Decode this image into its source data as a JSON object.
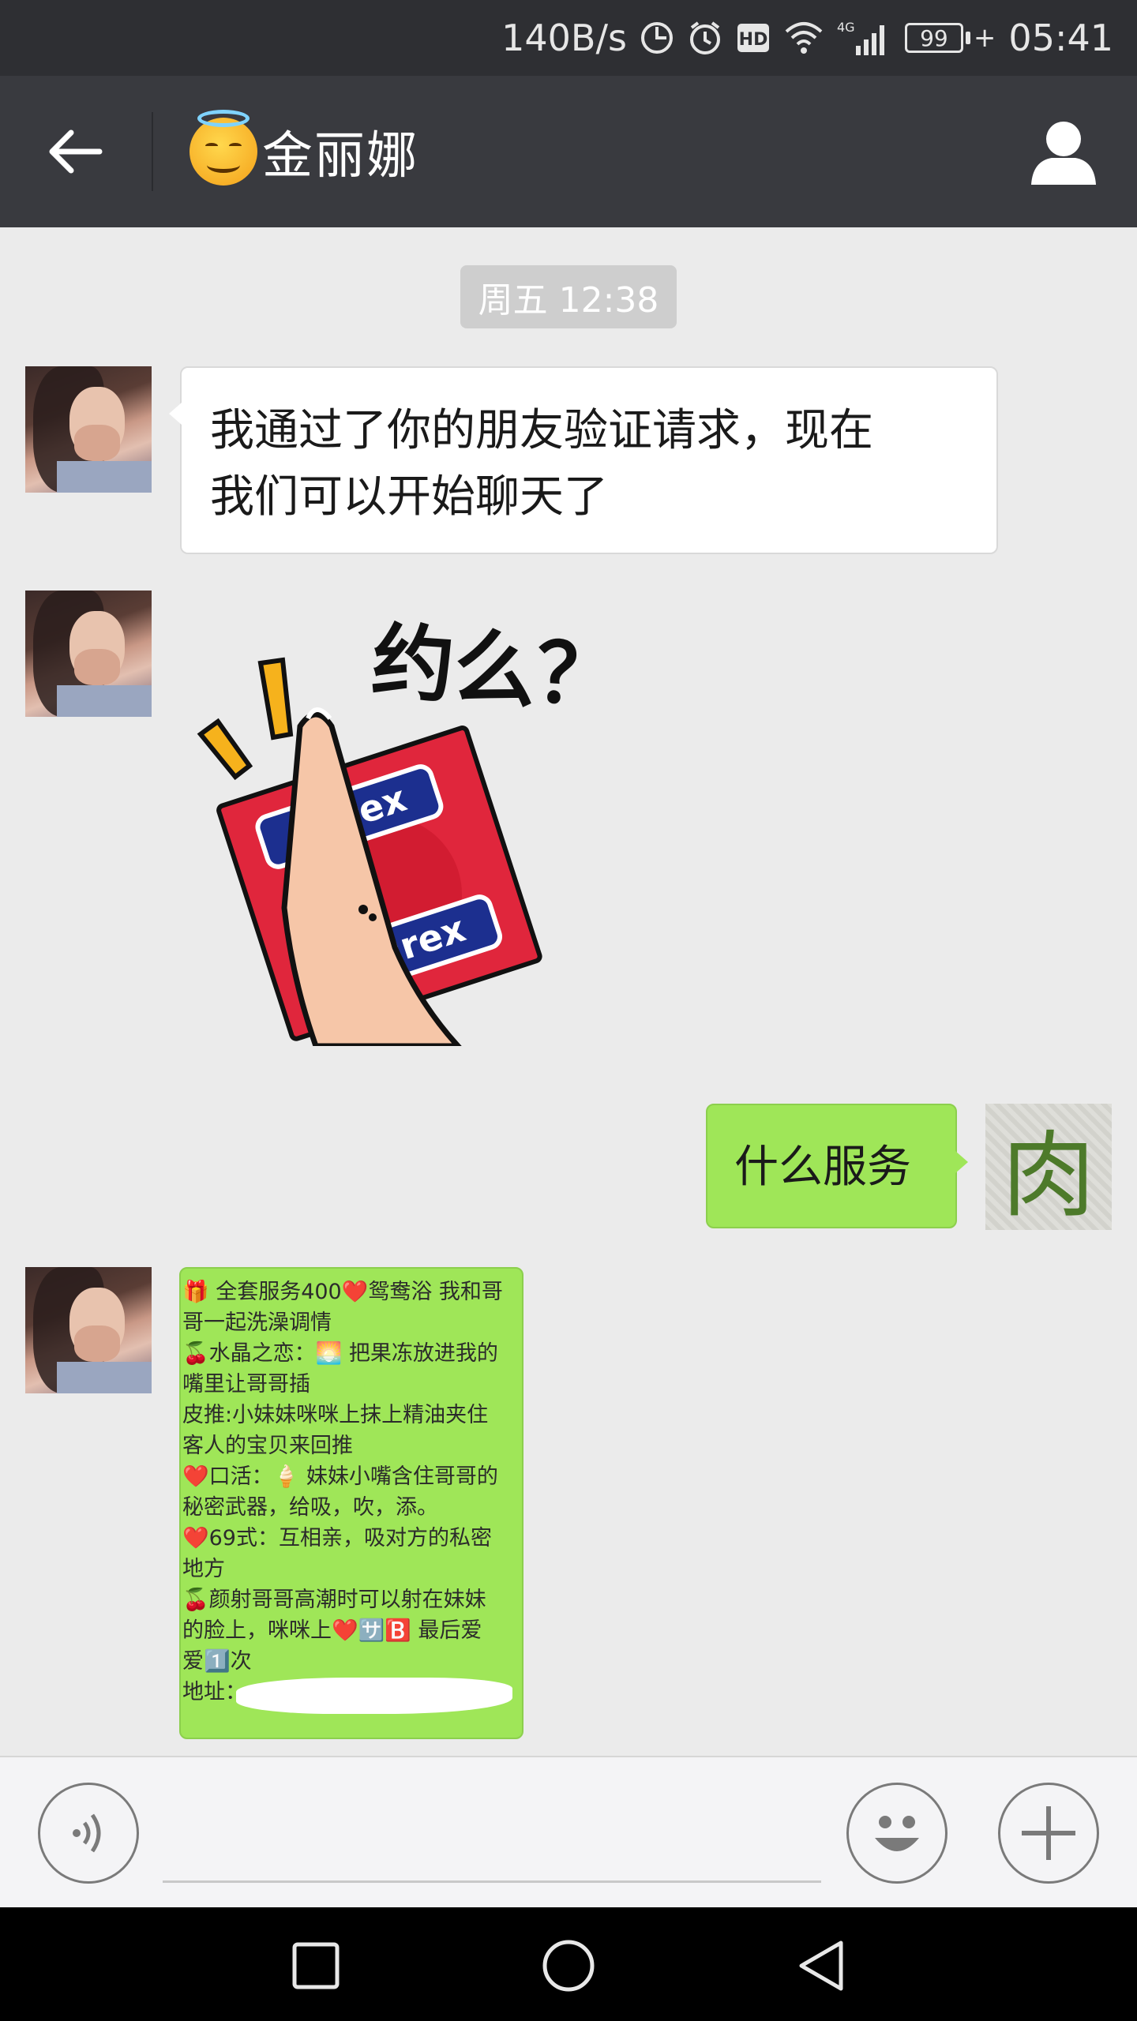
{
  "status_bar": {
    "network_speed": "140B/s",
    "network_type": "4G",
    "battery": "99",
    "time": "05:41",
    "icons": [
      "data-saver-icon",
      "alarm-icon",
      "hd-icon",
      "wifi-icon",
      "signal-icon",
      "battery-icon"
    ]
  },
  "header": {
    "title": "金丽娜",
    "title_emoji": "smiling-face-with-halo-emoji",
    "back_icon": "back-arrow-icon",
    "profile_icon": "person-icon"
  },
  "chat": {
    "timestamp": "周五 12:38",
    "messages": [
      {
        "from": "contact",
        "type": "text",
        "lines": [
          "我通过了你的朋友验证请求，现在",
          "我们可以开始聊天了"
        ]
      },
      {
        "from": "contact",
        "type": "sticker",
        "text": "约么？",
        "brand": "durex"
      },
      {
        "from": "me",
        "type": "text",
        "text": "什么服务"
      },
      {
        "from": "contact",
        "type": "image",
        "lines": [
          "🎁 全套服务400❤️鸳鸯浴 我和哥",
          "哥一起洗澡调情",
          "🍒水晶之恋：🌅 把果冻放进我的",
          "嘴里让哥哥插",
          "皮推:小妹妹咪咪上抹上精油夹住",
          "客人的宝贝来回推",
          "❤️口活：🍦 妹妹小嘴含住哥哥的",
          "秘密武器，给吸，吹，添。",
          "❤️69式：互相亲，吸对方的私密",
          "地方",
          "🍒颜射哥哥高潮时可以射在妹妹",
          "的脸上，咪咪上❤️🈂️🅱️ 最后爱",
          "爱1️⃣次",
          "地址："
        ]
      }
    ],
    "my_avatar_text": "肉"
  },
  "input_bar": {
    "voice_icon": "voice-icon",
    "emoji_icon": "emoji-icon",
    "more_icon": "plus-icon"
  },
  "nav_bar": {
    "icons": [
      "recent-apps-icon",
      "home-icon",
      "back-icon"
    ]
  }
}
